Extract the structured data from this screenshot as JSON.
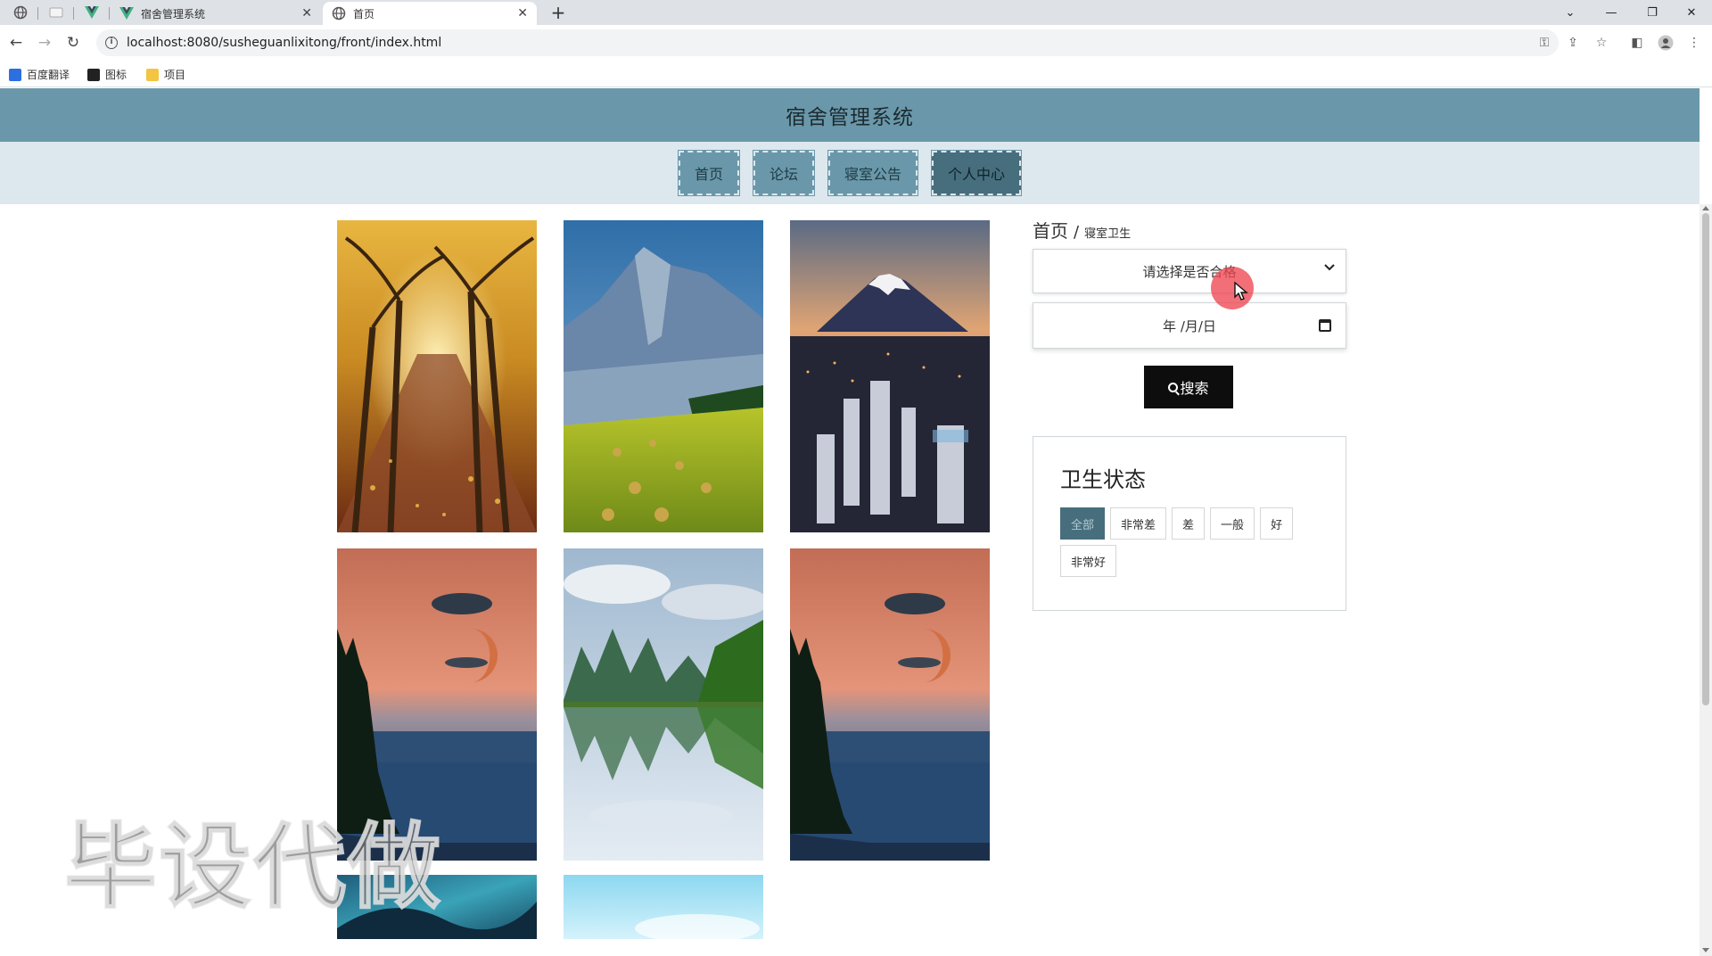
{
  "browser": {
    "tabs": [
      {
        "title": "宿舍管理系统",
        "active": false
      },
      {
        "title": "首页",
        "active": true
      }
    ],
    "new_tab": "+",
    "url": "localhost:8080/susheguanlixitong/front/index.html",
    "bookmarks": [
      {
        "label": "百度翻译",
        "icon": "baidu-translate-icon",
        "color": "#2b6fe0"
      },
      {
        "label": "图标",
        "icon": "image-icon",
        "color": "#222222"
      },
      {
        "label": "项目",
        "icon": "folder-icon",
        "color": "#f4c542"
      }
    ]
  },
  "site": {
    "title": "宿舍管理系统",
    "nav": [
      {
        "label": "首页",
        "active": false
      },
      {
        "label": "论坛",
        "active": false
      },
      {
        "label": "寝室公告",
        "active": false
      },
      {
        "label": "个人中心",
        "active": true
      }
    ]
  },
  "breadcrumb": {
    "home": "首页",
    "separator": "/",
    "current": "寝室卫生"
  },
  "filters": {
    "select_placeholder": "请选择是否合格",
    "date_placeholder": "年 /月/日",
    "search_label": "搜索"
  },
  "status_panel": {
    "title": "卫生状态",
    "tags": [
      {
        "label": "全部",
        "active": true
      },
      {
        "label": "非常差",
        "active": false
      },
      {
        "label": "差",
        "active": false
      },
      {
        "label": "一般",
        "active": false
      },
      {
        "label": "好",
        "active": false
      },
      {
        "label": "非常好",
        "active": false
      }
    ]
  },
  "gallery": {
    "images": [
      {
        "subject": "autumn-tree-avenue"
      },
      {
        "subject": "mountain-hay-field"
      },
      {
        "subject": "mount-fuji-city-night"
      },
      {
        "subject": "sunset-moon-lake"
      },
      {
        "subject": "karst-mountain-reflection"
      },
      {
        "subject": "sunset-moon-lake"
      },
      {
        "subject": "aurora-night"
      },
      {
        "subject": "sky-blue"
      }
    ]
  },
  "watermark": "毕设代做",
  "colors": {
    "header": "#6a98aa",
    "nav_bg": "#dde8ee",
    "active": "#476e7d",
    "button": "#0d0d0d"
  }
}
